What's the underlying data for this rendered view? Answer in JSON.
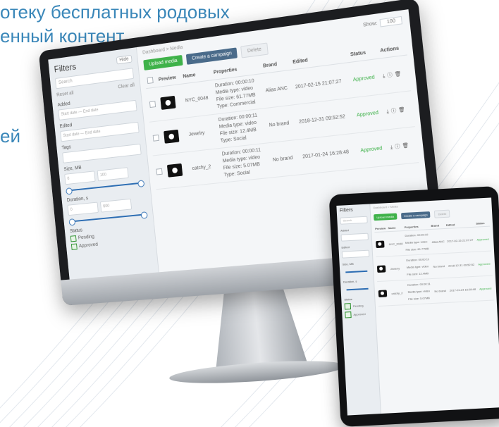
{
  "headline": {
    "line1": "отеку бесплатных родовых",
    "line2": "енный контент",
    "line3": "ей"
  },
  "colors": {
    "headline": "#3a87b9",
    "accent_green": "#3fb24a",
    "accent_blue": "#4a6b8a",
    "slider": "#2c6db3"
  },
  "app": {
    "breadcrumb": "Dashboard > Media",
    "sidebar": {
      "title": "Filters",
      "hide_label": "Hide",
      "search_placeholder": "Search",
      "reset_label": "Reset all",
      "clear_label": "Clear all",
      "added_label": "Added",
      "added_placeholder": "Start date — End date",
      "edited_label": "Edited",
      "edited_placeholder": "Start date — End date",
      "tags_label": "Tags",
      "size_label": "Size, MB",
      "size_min": "0",
      "size_max": "100",
      "duration_label": "Duration, s",
      "duration_min": "0",
      "duration_max": "600",
      "status_label": "Status",
      "status_options": [
        "Pending",
        "Approved"
      ]
    },
    "toolbar": {
      "upload": "Upload media",
      "create": "Create a campaign",
      "delete": "Delete",
      "show_label": "Show:",
      "show_value": "100"
    },
    "columns": [
      "Preview",
      "Name",
      "Properties",
      "Brand",
      "Edited",
      "Status",
      "Actions"
    ],
    "rows": [
      {
        "name": "NYC_0048",
        "duration": "Duration: 00:00:10",
        "media": "Media type: video",
        "size": "File size: 61.77MB",
        "type": "Type: Commercial",
        "brand": "Alias ANC",
        "edited": "2017-02-15 21:07:27",
        "status": "Approved"
      },
      {
        "name": "Jewelry",
        "duration": "Duration: 00:00:11",
        "media": "Media type: video",
        "size": "File size: 12.4MB",
        "type": "Type: Social",
        "brand": "No brand",
        "edited": "2018-12-31 09:52:52",
        "status": "Approved"
      },
      {
        "name": "catchy_2",
        "duration": "Duration: 00:00:11",
        "media": "Media type: video",
        "size": "File size: 5.07MB",
        "type": "Type: Social",
        "brand": "No brand",
        "edited": "2017-01-24 16:28:48",
        "status": "Approved"
      }
    ]
  }
}
